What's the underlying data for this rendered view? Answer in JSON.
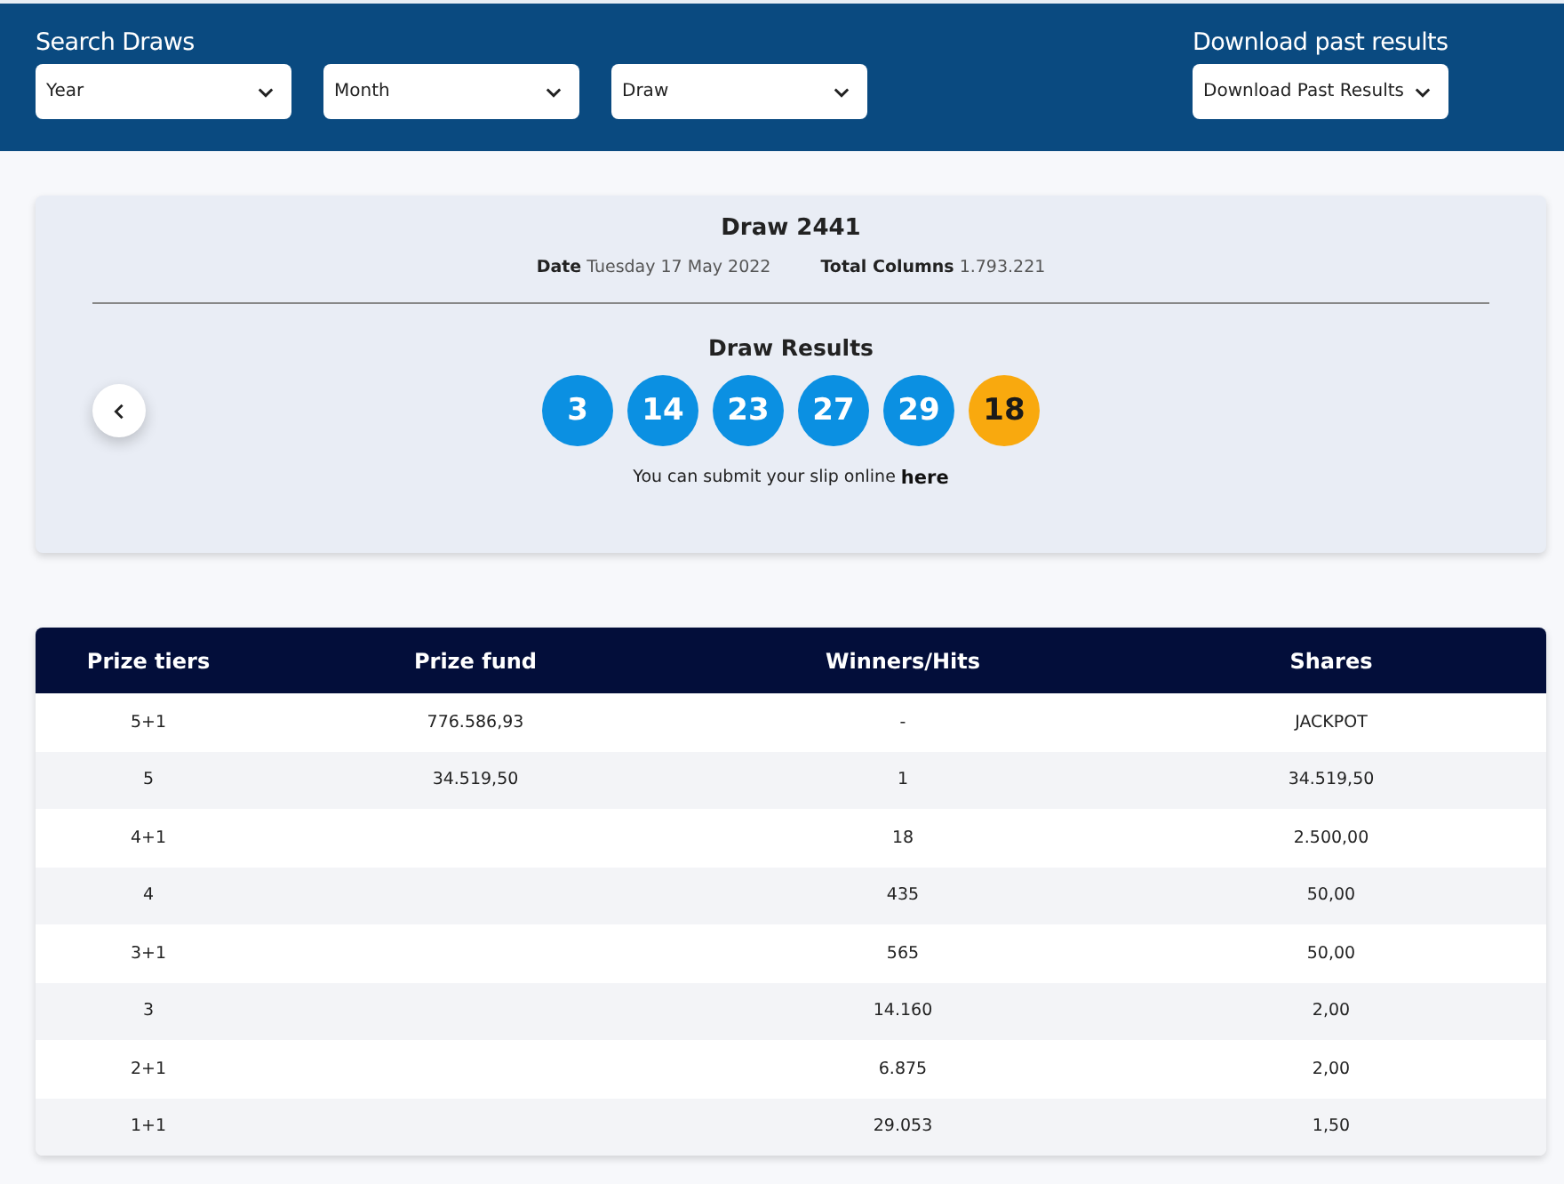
{
  "search": {
    "title": "Search Draws",
    "dropdowns": [
      {
        "value": "Year"
      },
      {
        "value": "Month"
      },
      {
        "value": "Draw"
      }
    ]
  },
  "download": {
    "title": "Download past results",
    "dropdown": {
      "value": "Download Past Results"
    }
  },
  "draw": {
    "title": "Draw 2441",
    "meta": [
      {
        "label": "Date",
        "value": "Tuesday 17 May 2022"
      },
      {
        "label": "Total Columns",
        "value": "1.793.221"
      }
    ],
    "results_title": "Draw Results",
    "balls": [
      {
        "number": "3",
        "kind": "main"
      },
      {
        "number": "14",
        "kind": "main"
      },
      {
        "number": "23",
        "kind": "main"
      },
      {
        "number": "27",
        "kind": "main"
      },
      {
        "number": "29",
        "kind": "main"
      },
      {
        "number": "18",
        "kind": "bonus"
      }
    ],
    "slip_text": "You can submit your slip online",
    "slip_link": "here"
  },
  "table": {
    "columns": [
      "Prize tiers",
      "Prize fund",
      "Winners/Hits",
      "Shares"
    ],
    "rows": [
      [
        "5+1",
        "776.586,93",
        "-",
        "JACKPOT"
      ],
      [
        "5",
        "34.519,50",
        "1",
        "34.519,50"
      ],
      [
        "4+1",
        "",
        "18",
        "2.500,00"
      ],
      [
        "4",
        "",
        "435",
        "50,00"
      ],
      [
        "3+1",
        "",
        "565",
        "50,00"
      ],
      [
        "3",
        "",
        "14.160",
        "2,00"
      ],
      [
        "2+1",
        "",
        "6.875",
        "2,00"
      ],
      [
        "1+1",
        "",
        "29.053",
        "1,50"
      ]
    ]
  }
}
